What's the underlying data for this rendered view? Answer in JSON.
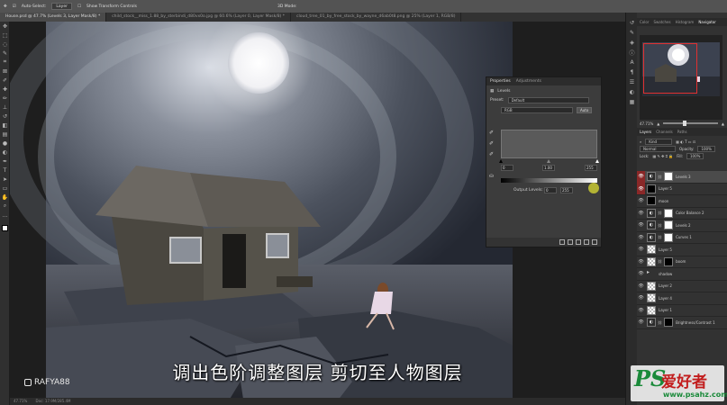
{
  "options_bar": {
    "auto_select": "Auto-Select:",
    "layer_select": "Layer",
    "show_transform": "Show Transform Controls",
    "mode_3d": "3D Mode:"
  },
  "tabs": [
    {
      "label": "House.psd @ 47.7% (Levels 3, Layer Mask/8) *"
    },
    {
      "label": "child_stock__miss_1.88_by_sterbindi_d80vx0o.jpg @ 60.6% (Layer 0, Layer Mask/8) *"
    },
    {
      "label": "cloud_tree_01_by_free_stock_by_wayne_d6ab0t8.png @ 25% (Layer 1, RGB/8)"
    }
  ],
  "status": {
    "zoom": "47.71%",
    "doc": "Doc: 17.9M/285.4M"
  },
  "properties": {
    "tab_properties": "Properties",
    "tab_adjustments": "Adjustments",
    "adjustment_name": "Levels",
    "preset_label": "Preset:",
    "preset_value": "Default",
    "channel": "RGB",
    "auto_label": "Auto",
    "input_black": "0",
    "input_gray": "1.00",
    "input_white": "255",
    "output_label": "Output Levels:",
    "output_black": "0",
    "output_white": "255"
  },
  "right_panel": {
    "tabs": [
      "Color",
      "Swatches",
      "Histogram",
      "Navigator"
    ],
    "active_tab": "Navigator",
    "zoom": "47.71%",
    "layers_tabs": [
      "Layers",
      "Channels",
      "Paths"
    ],
    "kind_label": "Kind",
    "blend_mode": "Normal",
    "opacity_label": "Opacity:",
    "opacity_value": "100%",
    "lock_label": "Lock:",
    "fill_label": "Fill:",
    "fill_value": "100%"
  },
  "layers": [
    {
      "name": "Levels 3",
      "thumb": "adj",
      "mask": "mask",
      "selected": true
    },
    {
      "name": "Layer 5",
      "thumb": "black",
      "mask": "",
      "selected": false
    },
    {
      "name": "moon",
      "thumb": "black",
      "mask": "",
      "selected": false
    },
    {
      "name": "Color Balance 2",
      "thumb": "adj",
      "mask": "mask",
      "selected": false
    },
    {
      "name": "Levels 2",
      "thumb": "adj",
      "mask": "mask",
      "selected": false
    },
    {
      "name": "Curves 1",
      "thumb": "adj",
      "mask": "mask",
      "selected": false
    },
    {
      "name": "Layer 5",
      "thumb": "checker",
      "mask": "",
      "selected": false
    },
    {
      "name": "boom",
      "thumb": "checker",
      "mask": "black",
      "selected": false
    },
    {
      "name": "shadow",
      "thumb": "folder",
      "mask": "",
      "selected": false
    },
    {
      "name": "Layer 2",
      "thumb": "checker",
      "mask": "",
      "selected": false
    },
    {
      "name": "Layer 4",
      "thumb": "checker",
      "mask": "",
      "selected": false
    },
    {
      "name": "Layer 1",
      "thumb": "checker",
      "mask": "",
      "selected": false
    },
    {
      "name": "Brightness/Contrast 1",
      "thumb": "adj",
      "mask": "black",
      "selected": false
    }
  ],
  "subtitle": "调出色阶调整图层 剪切至人物图层",
  "watermark": "RAFYA88",
  "logo": {
    "big": "PS",
    "cn": "爱好者",
    "url": "www.psahz.com"
  }
}
